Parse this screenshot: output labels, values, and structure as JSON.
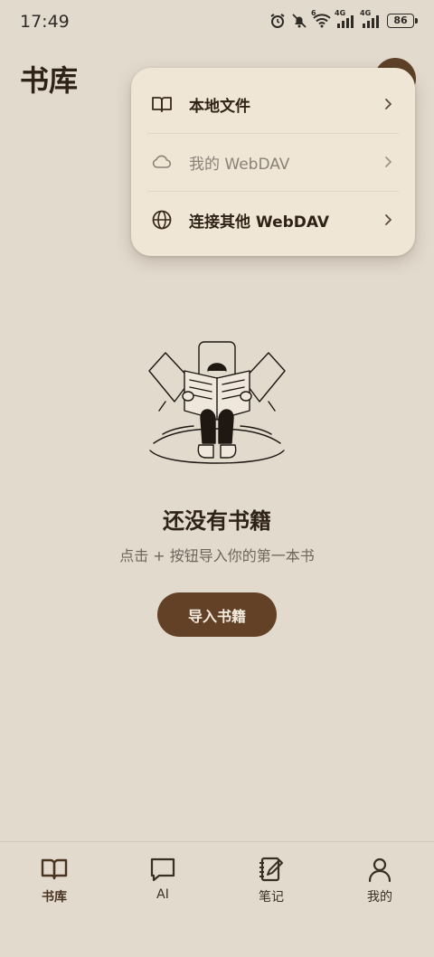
{
  "status_bar": {
    "time": "17:49",
    "network_1": "4G",
    "network_2": "4G",
    "wifi_badge": "6",
    "battery": "86"
  },
  "header": {
    "title": "书库"
  },
  "menu": {
    "items": [
      {
        "label": "本地文件",
        "icon": "book-open-icon",
        "enabled": true
      },
      {
        "label": "我的 WebDAV",
        "icon": "cloud-icon",
        "enabled": false
      },
      {
        "label": "连接其他 WebDAV",
        "icon": "globe-icon",
        "enabled": true
      }
    ]
  },
  "empty_state": {
    "title": "还没有书籍",
    "subtitle": "点击 + 按钮导入你的第一本书",
    "button_label": "导入书籍"
  },
  "bottom_nav": {
    "items": [
      {
        "label": "书库",
        "icon": "book-open-icon",
        "active": true
      },
      {
        "label": "AI",
        "icon": "chat-bubble-icon",
        "active": false
      },
      {
        "label": "笔记",
        "icon": "notebook-edit-icon",
        "active": false
      },
      {
        "label": "我的",
        "icon": "user-icon",
        "active": false
      }
    ]
  },
  "colors": {
    "background": "#e3dace",
    "menu_background": "#f0e6d6",
    "accent_brown": "#634127",
    "text_dark": "#2f2216",
    "text_muted": "#6f655b"
  }
}
